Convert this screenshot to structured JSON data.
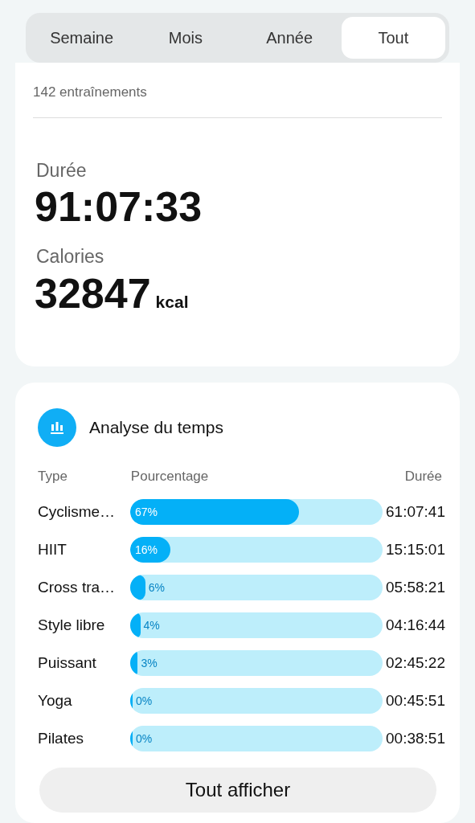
{
  "tabs": [
    {
      "label": "Semaine",
      "selected": false
    },
    {
      "label": "Mois",
      "selected": false
    },
    {
      "label": "Année",
      "selected": false
    },
    {
      "label": "Tout",
      "selected": true
    }
  ],
  "summary": {
    "count": "142 entraînements",
    "duration_label": "Durée",
    "duration": "91:07:33",
    "calories_label": "Calories",
    "calories": "32847",
    "calories_unit": "kcal"
  },
  "analysis": {
    "title": "Analyse du temps",
    "columns": [
      "Type",
      "Pourcentage",
      "Durée"
    ],
    "rows": [
      {
        "type": "Cyclisme…",
        "percent": "67%",
        "level": 0.67,
        "duration": "61:07:41"
      },
      {
        "type": "HIIT",
        "percent": "16%",
        "level": 0.16,
        "duration": "15:15:01"
      },
      {
        "type": "Cross tra…",
        "percent": "6%",
        "level": 0.06,
        "duration": "05:58:21"
      },
      {
        "type": "Style libre",
        "percent": "4%",
        "level": 0.04,
        "duration": "04:16:44"
      },
      {
        "type": "Puissant",
        "percent": "3%",
        "level": 0.03,
        "duration": "02:45:22"
      },
      {
        "type": "Yoga",
        "percent": "0%",
        "level": 0,
        "duration": "00:45:51"
      },
      {
        "type": "Pilates",
        "percent": "0%",
        "level": 0,
        "duration": "00:38:51"
      }
    ],
    "button": "Tout afficher"
  }
}
